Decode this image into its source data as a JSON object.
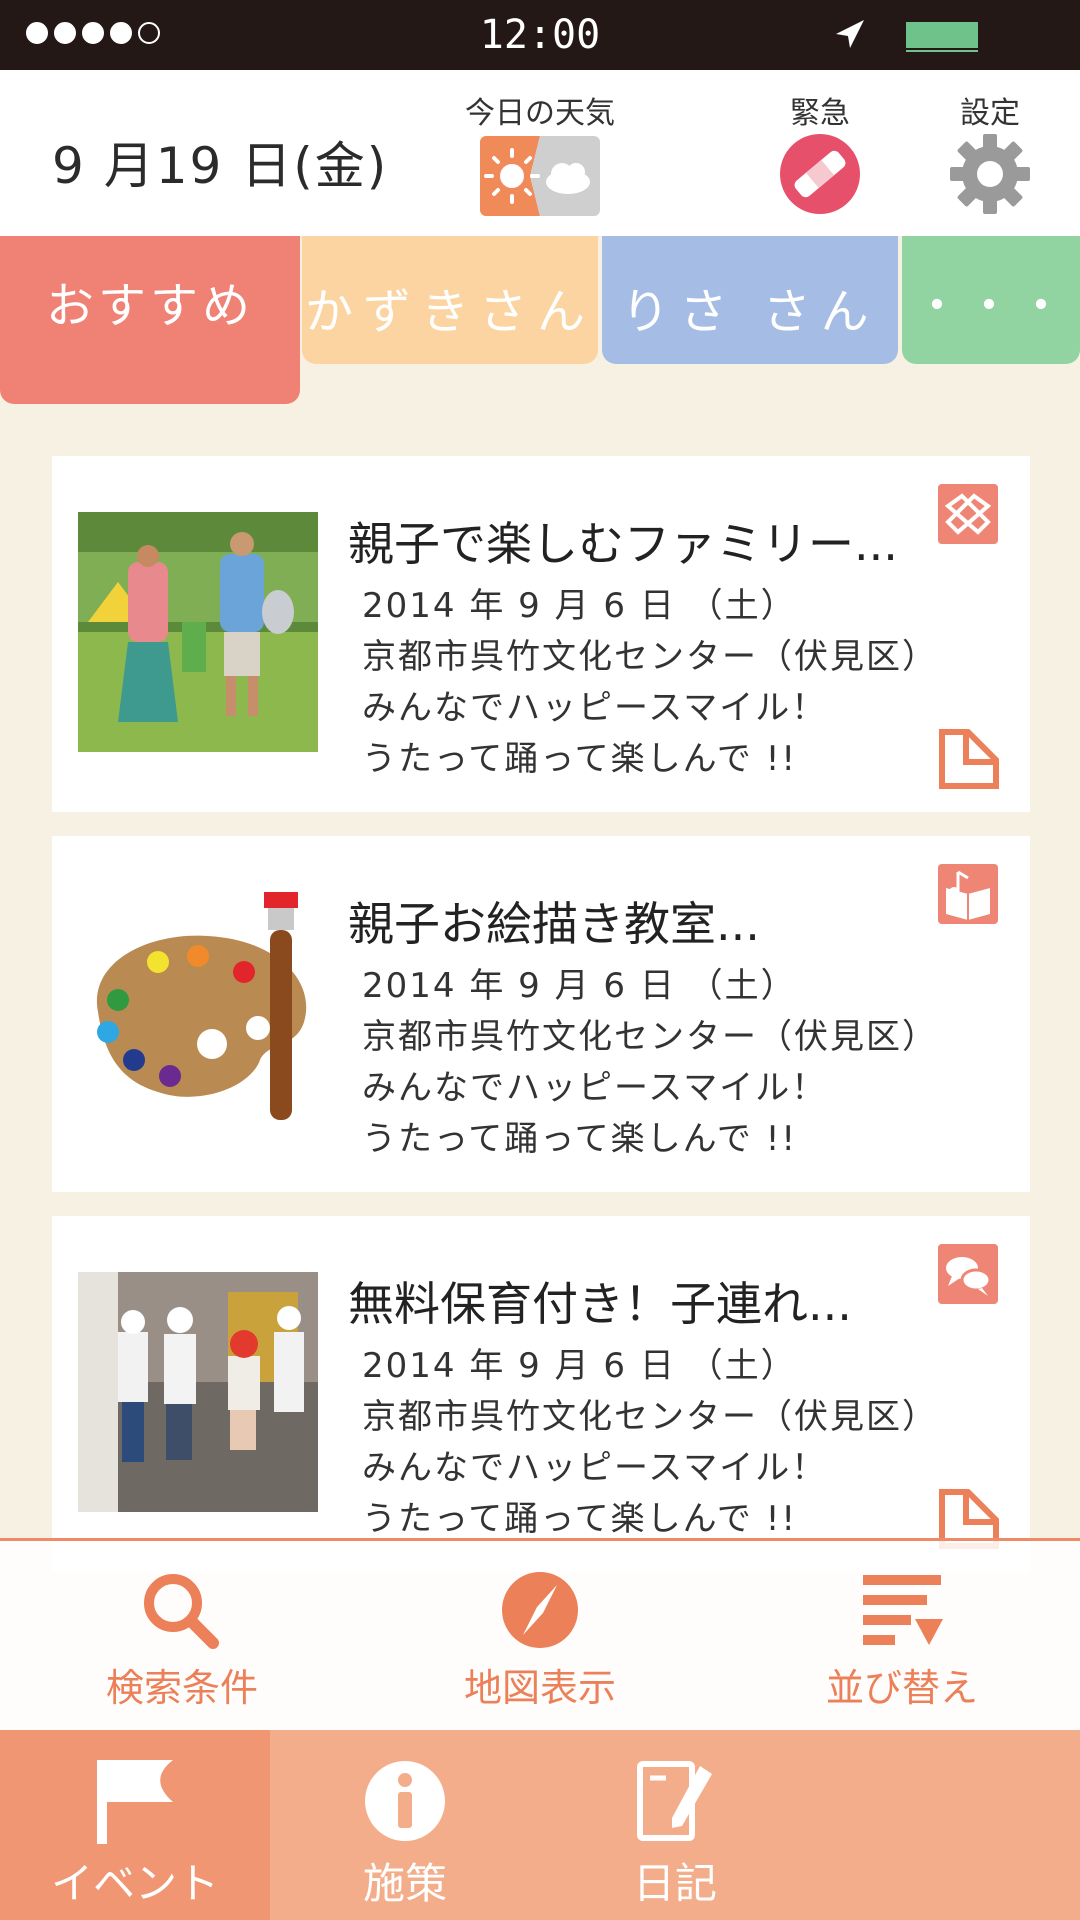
{
  "status_bar": {
    "signal_dots_filled": 4,
    "signal_dots_total": 5,
    "time": "12:00",
    "battery_level": 0.95,
    "icons": [
      "location-arrow-icon",
      "battery-icon"
    ]
  },
  "header": {
    "date": "9 月19 日(金)",
    "weather_label": "今日の天気",
    "weather_icon": "sun-cloud-icon",
    "emergency_label": "緊急",
    "emergency_icon": "bandage-icon",
    "settings_label": "設定",
    "settings_icon": "gear-icon"
  },
  "tabs": [
    {
      "label": "おすすめ",
      "color": "#ef8175",
      "active": true
    },
    {
      "label": "かずきさん",
      "color": "#fbd4a1"
    },
    {
      "label": "りさ さん",
      "color": "#a5bde4"
    },
    {
      "label": "・・・",
      "color": "#91d3a1"
    }
  ],
  "events": [
    {
      "title": "親子で楽しむファミリー...",
      "date": "2014 年 9 月 6 日 （土）",
      "venue": "京都市呉竹文化センター（伏見区）",
      "desc1": "みんなでハッピースマイル！",
      "desc2": "うたって踊って楽しんで !!",
      "thumb": "family-park-photo",
      "category_icon": "handshake-icon"
    },
    {
      "title": "親子お絵描き教室...",
      "date": "2014 年 9 月 6 日 （土）",
      "venue": "京都市呉竹文化センター（伏見区）",
      "desc1": "みんなでハッピースマイル！",
      "desc2": "うたって踊って楽しんで !!",
      "thumb": "paint-palette-illustration",
      "category_icon": "music-book-icon"
    },
    {
      "title": "無料保育付き！子連れ...",
      "date": "2014 年 9 月 6 日 （土）",
      "venue": "京都市呉竹文化センター（伏見区）",
      "desc1": "みんなでハッピースマイル！",
      "desc2": "うたって踊って楽しんで !!",
      "thumb": "kids-playground-photo",
      "category_icon": "chat-bubbles-icon"
    }
  ],
  "filter_bar": {
    "search_label": "検索条件",
    "map_label": "地図表示",
    "sort_label": "並び替え"
  },
  "bottom_nav": {
    "event_label": "イベント",
    "policy_label": "施策",
    "diary_label": "日記"
  },
  "colors": {
    "accent": "#ec8058",
    "nav_bg": "#f4ad8b",
    "nav_active": "#f09673",
    "page_bg": "#f7f1e3"
  }
}
